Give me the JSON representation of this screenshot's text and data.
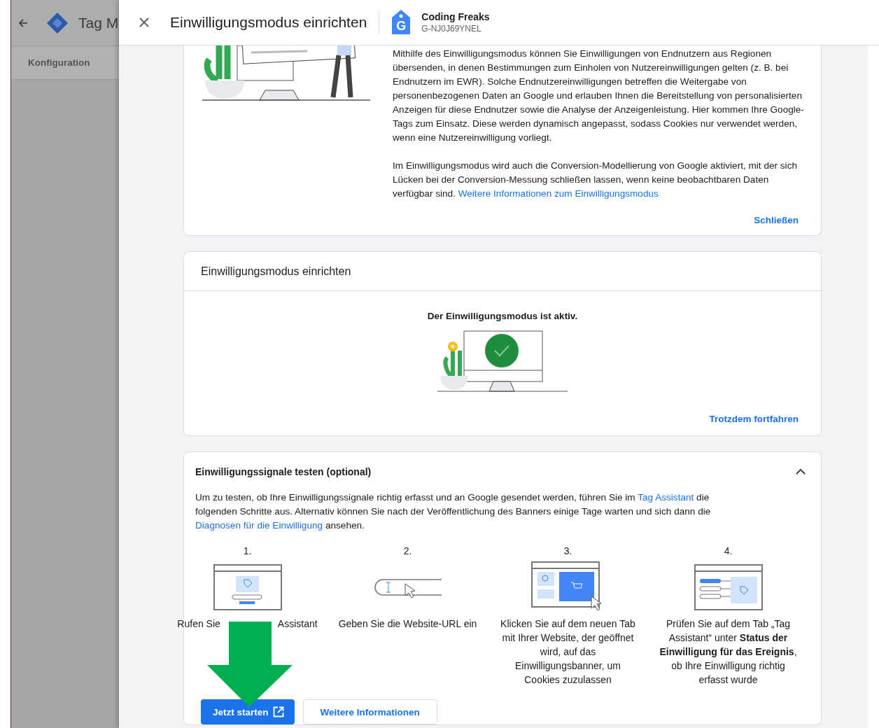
{
  "background_app": {
    "title": "Tag M",
    "nav_item": "Konfiguration"
  },
  "dialog": {
    "title": "Einwilligungsmodus einrichten",
    "account_letter": "G",
    "account_name": "Coding Freaks",
    "account_id": "G-NJ0J69YNEL"
  },
  "intro_card": {
    "paragraphs": [
      [
        {
          "kind": "text",
          "text": "Mithilfe des Einwilligungsmodus können Sie Einwilligungen von Endnutzern aus Regionen übersenden, in denen Bestimmungen zum Einholen von Nutzereinwilligungen gelten (z. B. bei Endnutzern im EWR). Solche Endnutzereinwilligungen betreffen die Weitergabe von personenbezogenen Daten an Google und erlauben Ihnen die Bereitstellung von personalisierten Anzeigen für diese Endnutzer sowie die Analyse der Anzeigenleistung. Hier kommen Ihre Google-Tags zum Einsatz. Diese werden dynamisch angepasst, sodass Cookies nur verwendet werden, wenn eine Nutzereinwilligung vorliegt."
        }
      ],
      [
        {
          "kind": "text",
          "text": "Im Einwilligungsmodus wird auch die Conversion-Modellierung von Google aktiviert, mit der sich Lücken bei der Conversion-Messung schließen lassen, wenn keine beobachtbaren Daten verfügbar sind. "
        },
        {
          "kind": "link",
          "text": "Weitere Informationen zum Einwilligungsmodus"
        }
      ]
    ],
    "close_button": "Schließen"
  },
  "setup_card": {
    "title": "Einwilligungsmodus einrichten",
    "status": "Der Einwilligungsmodus ist aktiv.",
    "continue_button": "Trotzdem fortfahren"
  },
  "test_card": {
    "title": "Einwilligungssignale testen (optional)",
    "expanded": true,
    "description": [
      {
        "kind": "text",
        "text": "Um zu testen, ob Ihre Einwilligungssignale richtig erfasst und an Google gesendet werden, führen Sie im "
      },
      {
        "kind": "link",
        "text": "Tag Assistant"
      },
      {
        "kind": "text",
        "text": " die folgenden Schritte aus. Alternativ können Sie nach der Veröffentlichung des Banners einige Tage warten und sich dann die "
      },
      {
        "kind": "link",
        "text": "Diagnosen für die Einwilligung"
      },
      {
        "kind": "text",
        "text": " ansehen."
      }
    ],
    "steps": [
      {
        "number": "1.",
        "kind": "tag-page",
        "parts": [
          "Rufen Sie",
          "Assistant"
        ]
      },
      {
        "number": "2.",
        "kind": "url-field",
        "parts": [
          "Geben Sie die Website-URL ein"
        ]
      },
      {
        "number": "3.",
        "kind": "site-click",
        "parts": [
          "Klicken Sie auf dem neuen Tab mit Ihrer Website, der geöffnet wird, auf das Einwilligungsbanner, um Cookies zuzulassen"
        ]
      },
      {
        "number": "4.",
        "kind": "tag-status",
        "parts": [
          "Prüfen Sie auf dem Tab „Tag Assistant“ unter **Status der Einwilligung für das Ereignis**, ob Ihre Einwilligung richtig erfasst wurde"
        ]
      }
    ],
    "primary_button": "Jetzt starten",
    "secondary_button": "Weitere Informationen"
  }
}
